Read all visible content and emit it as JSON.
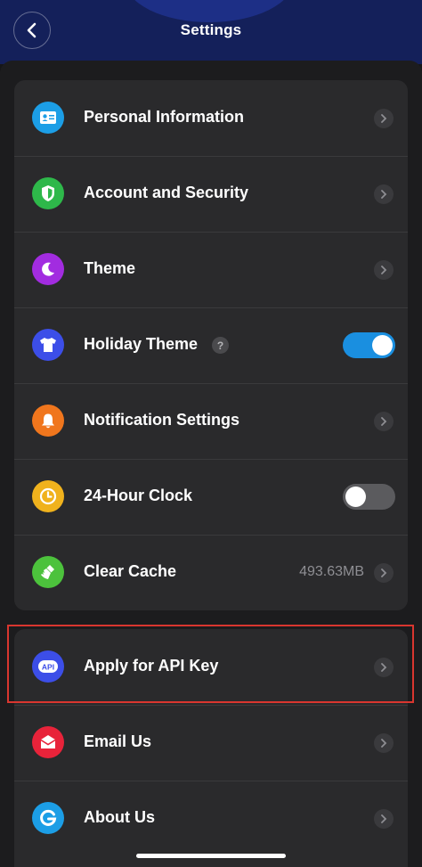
{
  "header": {
    "title": "Settings"
  },
  "group1": [
    {
      "label": "Personal Information",
      "icon": "id-card-icon",
      "color": "#1c9ee6",
      "accessory": "chevron"
    },
    {
      "label": "Account and Security",
      "icon": "shield-icon",
      "color": "#2eb84a",
      "accessory": "chevron"
    },
    {
      "label": "Theme",
      "icon": "moon-icon",
      "color": "#a22ce0",
      "accessory": "chevron"
    },
    {
      "label": "Holiday Theme",
      "icon": "tshirt-icon",
      "color": "#3c4ee8",
      "accessory": "toggle",
      "toggle_on": true,
      "help": "?"
    },
    {
      "label": "Notification Settings",
      "icon": "bell-icon",
      "color": "#f0761d",
      "accessory": "chevron"
    },
    {
      "label": "24-Hour Clock",
      "icon": "clock-icon",
      "color": "#f0b21d",
      "accessory": "toggle",
      "toggle_on": false
    },
    {
      "label": "Clear Cache",
      "icon": "broom-icon",
      "color": "#4cc23c",
      "accessory": "chevron",
      "value": "493.63MB"
    }
  ],
  "group2": [
    {
      "label": "Apply for API Key",
      "icon": "api-icon",
      "color": "#3c4ee8",
      "accessory": "chevron",
      "icon_text": "API"
    },
    {
      "label": "Email Us",
      "icon": "envelope-icon",
      "color": "#e8233a",
      "accessory": "chevron"
    },
    {
      "label": "About Us",
      "icon": "info-g-icon",
      "color": "#1c9ee6",
      "accessory": "chevron"
    }
  ],
  "colors": {
    "header_bg": "#14205a",
    "card_bg": "#2a2a2c",
    "toggle_on": "#1a8fe0",
    "highlight": "#d9362f"
  }
}
